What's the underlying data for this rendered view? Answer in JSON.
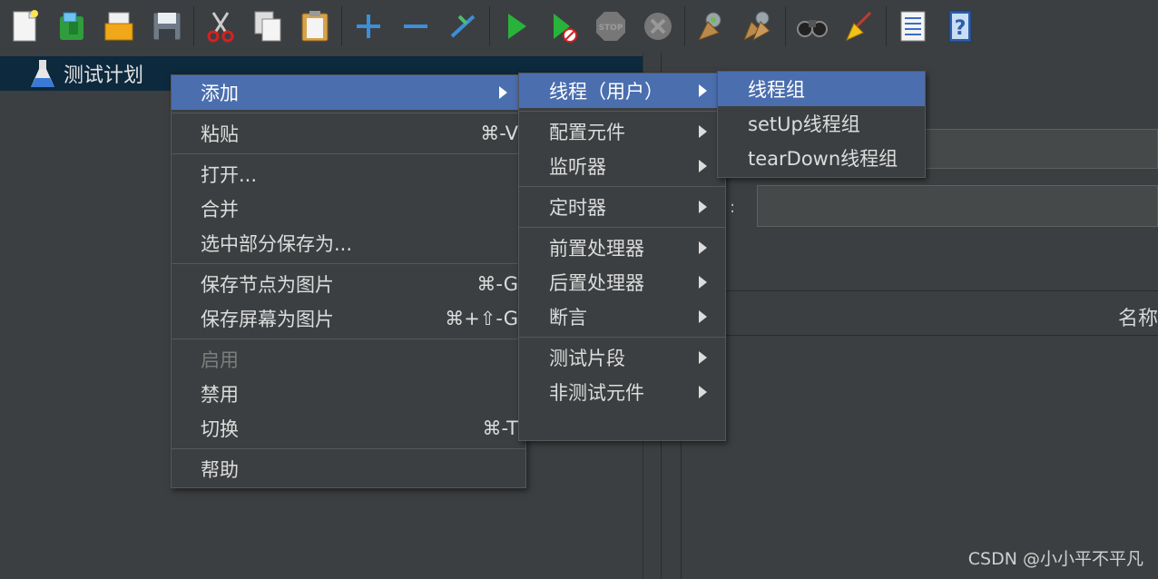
{
  "toolbar": {
    "buttons": [
      {
        "icon": "new-icon"
      },
      {
        "icon": "templates-icon"
      },
      {
        "icon": "open-icon"
      },
      {
        "icon": "save-icon"
      },
      {
        "icon": "cut-icon"
      },
      {
        "icon": "copy-icon"
      },
      {
        "icon": "paste-icon"
      },
      {
        "icon": "expand-icon"
      },
      {
        "icon": "collapse-icon"
      },
      {
        "icon": "toggle-icon"
      },
      {
        "icon": "start-icon"
      },
      {
        "icon": "start-no-pauses-icon"
      },
      {
        "icon": "stop-icon"
      },
      {
        "icon": "shutdown-icon"
      },
      {
        "icon": "clear-icon"
      },
      {
        "icon": "clear-all-icon"
      },
      {
        "icon": "search-icon"
      },
      {
        "icon": "reset-search-icon"
      },
      {
        "icon": "function-helper-icon"
      },
      {
        "icon": "help-icon"
      }
    ],
    "stop_text": "STOP"
  },
  "tree": {
    "root_label": "测试计划"
  },
  "context_menu": {
    "items": [
      {
        "label": "添加",
        "shortcut": "",
        "submenu": true,
        "selected": true
      },
      {
        "label": "粘贴",
        "shortcut": "⌘-V"
      },
      {
        "label": "打开...",
        "shortcut": ""
      },
      {
        "label": "合并",
        "shortcut": ""
      },
      {
        "label": "选中部分保存为...",
        "shortcut": ""
      },
      {
        "label": "保存节点为图片",
        "shortcut": "⌘-G"
      },
      {
        "label": "保存屏幕为图片",
        "shortcut": "⌘+⇧-G"
      },
      {
        "label": "启用",
        "shortcut": "",
        "disabled": true
      },
      {
        "label": "禁用",
        "shortcut": ""
      },
      {
        "label": "切换",
        "shortcut": "⌘-T"
      },
      {
        "label": "帮助",
        "shortcut": ""
      }
    ]
  },
  "add_submenu": {
    "items": [
      {
        "label": "线程（用户）"
      },
      {
        "label": "配置元件"
      },
      {
        "label": "监听器"
      },
      {
        "label": "定时器"
      },
      {
        "label": "前置处理器"
      },
      {
        "label": "后置处理器"
      },
      {
        "label": "断言"
      },
      {
        "label": "测试片段"
      },
      {
        "label": "非测试元件"
      }
    ]
  },
  "thread_submenu": {
    "items": [
      {
        "label": "线程组"
      },
      {
        "label": "setUp线程组"
      },
      {
        "label": "tearDown线程组"
      }
    ]
  },
  "right_panel": {
    "colon": ":",
    "table_header": "名称"
  },
  "watermark": "CSDN @小小平不平凡",
  "colors": {
    "selection": "#4b6eaf",
    "tree_selection": "#0d293e",
    "background": "#3c3f41"
  }
}
